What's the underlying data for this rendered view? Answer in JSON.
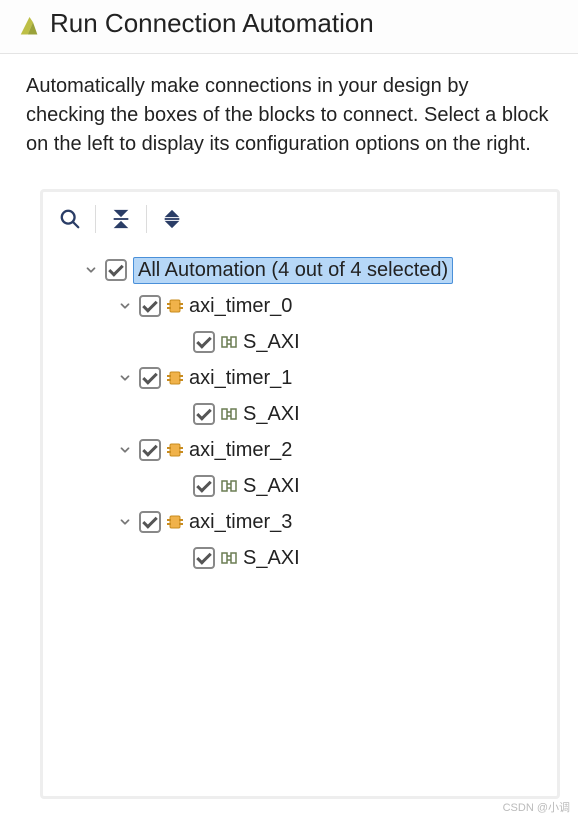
{
  "dialog": {
    "title": "Run Connection Automation",
    "description": "Automatically make connections in your design by checking the boxes of the blocks to connect. Select a block on the left to display its configuration options on the right."
  },
  "toolbar": {
    "icons": {
      "search": "search-icon",
      "collapse": "collapse-all-icon",
      "expand": "expand-all-icon"
    }
  },
  "tree": {
    "root": {
      "label": "All Automation (4 out of 4 selected)",
      "checked": true,
      "expanded": true,
      "selected": true
    },
    "nodes": [
      {
        "label": "axi_timer_0",
        "checked": true,
        "expanded": true,
        "children": [
          {
            "label": "S_AXI",
            "checked": true
          }
        ]
      },
      {
        "label": "axi_timer_1",
        "checked": true,
        "expanded": true,
        "children": [
          {
            "label": "S_AXI",
            "checked": true
          }
        ]
      },
      {
        "label": "axi_timer_2",
        "checked": true,
        "expanded": true,
        "children": [
          {
            "label": "S_AXI",
            "checked": true
          }
        ]
      },
      {
        "label": "axi_timer_3",
        "checked": true,
        "expanded": true,
        "children": [
          {
            "label": "S_AXI",
            "checked": true
          }
        ]
      }
    ]
  },
  "watermark": "CSDN @小调"
}
